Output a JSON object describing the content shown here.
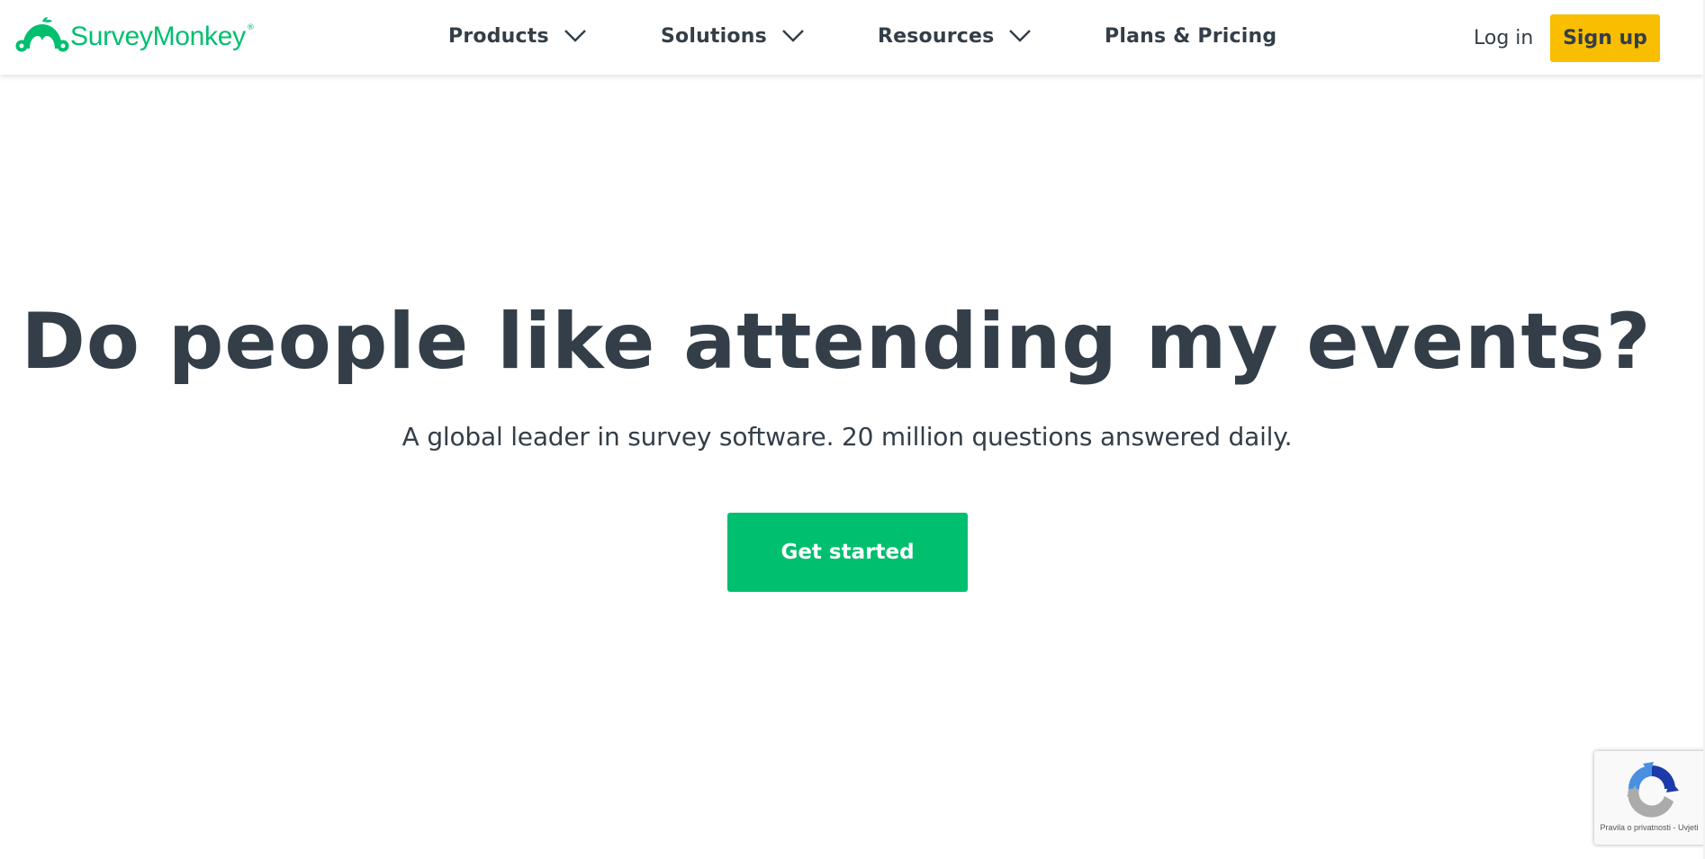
{
  "brand": {
    "name": "SurveyMonkey",
    "registered_mark": "®",
    "color": "#00bf6f"
  },
  "nav": {
    "items": [
      {
        "label": "Products",
        "has_dropdown": true,
        "icon": "chevron-down-icon"
      },
      {
        "label": "Solutions",
        "has_dropdown": true,
        "icon": "chevron-down-icon"
      },
      {
        "label": "Resources",
        "has_dropdown": true,
        "icon": "chevron-down-icon"
      },
      {
        "label": "Plans & Pricing",
        "has_dropdown": false
      }
    ],
    "login_label": "Log in",
    "signup_label": "Sign up",
    "signup_color": "#f9be00"
  },
  "hero": {
    "title": "Do people like attending my events?",
    "subtitle": "A global leader in survey software. 20 million questions answered daily.",
    "cta_label": "Get started",
    "cta_color": "#00bf6f"
  },
  "recaptcha": {
    "icon": "recaptcha-icon",
    "privacy_label": "Pravila o privatnosti",
    "separator": "-",
    "terms_label": "Uvjeti"
  }
}
